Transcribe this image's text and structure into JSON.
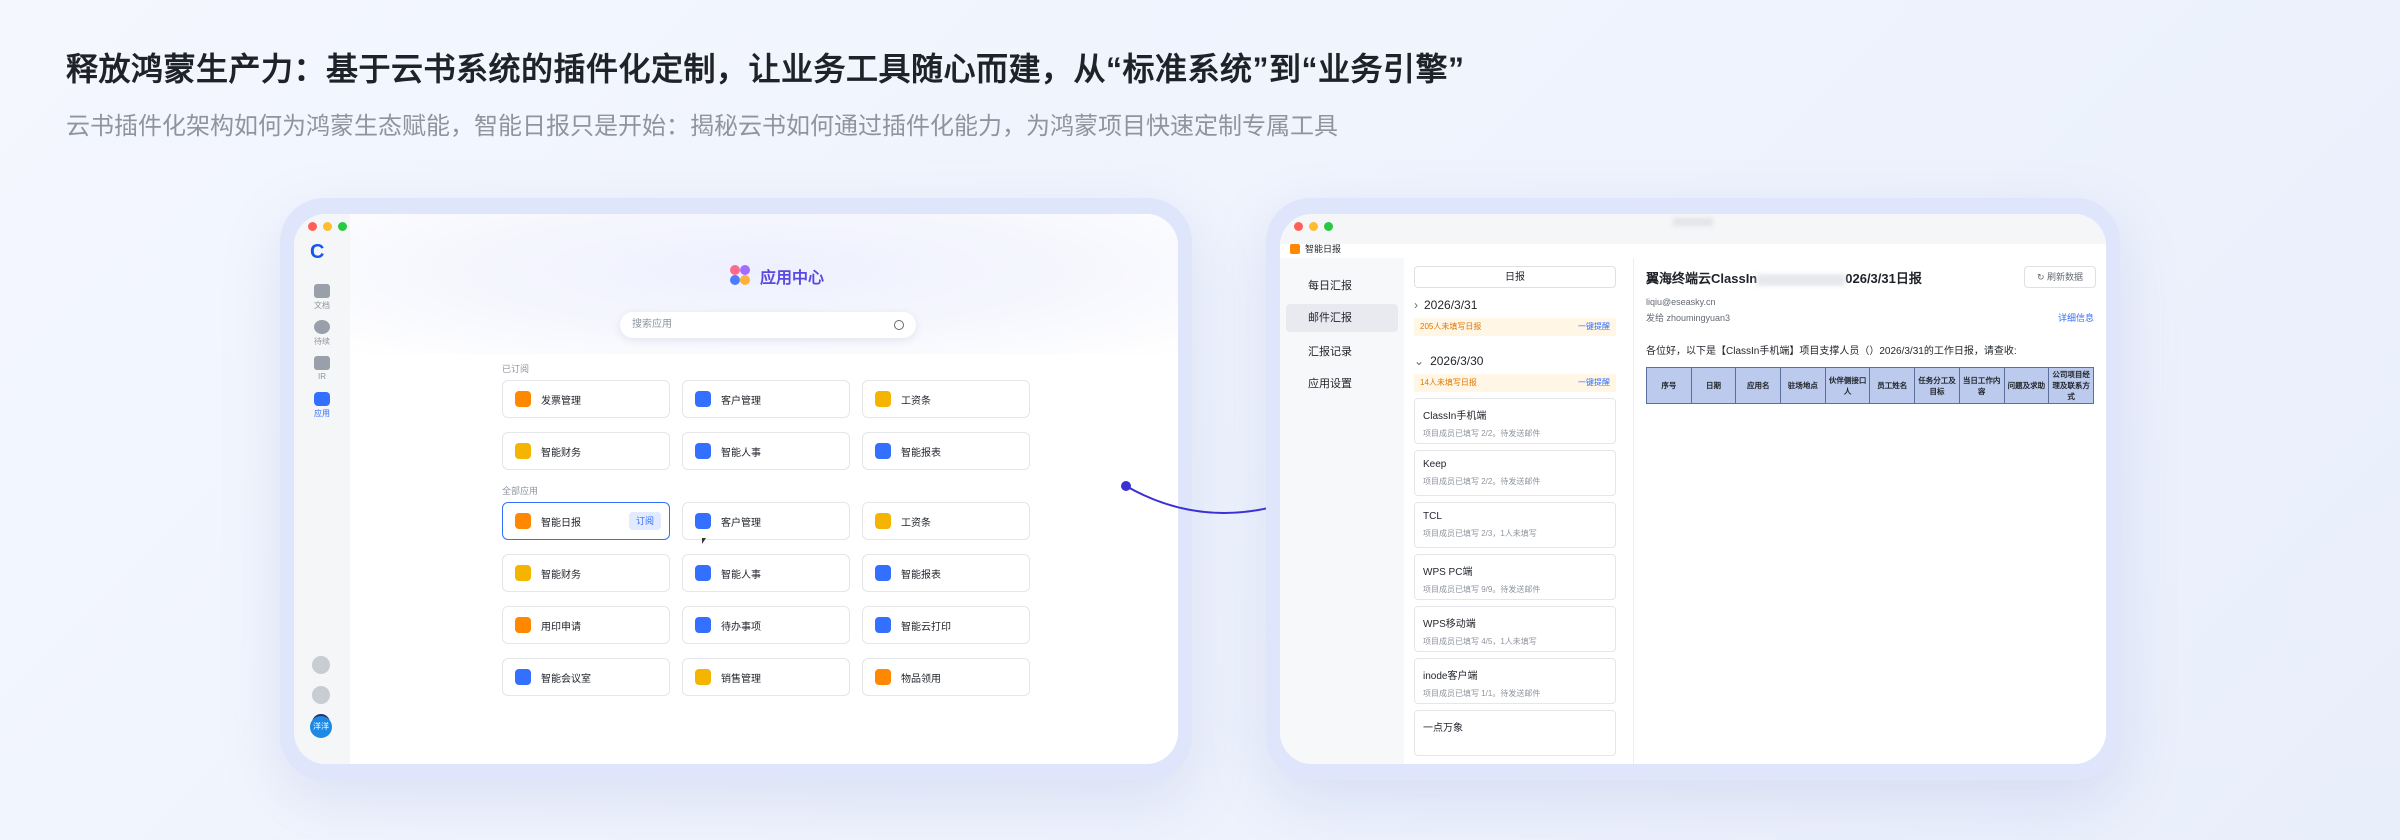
{
  "headline": "释放鸿蒙生产力：基于云书系统的插件化定制，让业务工具随心而建，从“标准系统”到“业务引擎”",
  "subline": "云书插件化架构如何为鸿蒙生态赋能，智能日报只是开始：揭秘云书如何通过插件化能力，为鸿蒙项目快速定制专属工具",
  "left_app": {
    "sidebar": {
      "items": [
        {
          "label": "文档"
        },
        {
          "label": "待续"
        },
        {
          "label": "IR"
        },
        {
          "label": "应用"
        }
      ],
      "avatar": "洋洋"
    },
    "hero_title": "应用中心",
    "search_placeholder": "搜索应用",
    "subscribed_label": "已订阅",
    "all_label": "全部应用",
    "subscribe_btn": "订阅",
    "subscribed": [
      {
        "label": "发票管理",
        "color": "#ff8800"
      },
      {
        "label": "客户管理",
        "color": "#3370ff"
      },
      {
        "label": "工资条",
        "color": "#f5b400"
      },
      {
        "label": "智能财务",
        "color": "#f5b400"
      },
      {
        "label": "智能人事",
        "color": "#3370ff"
      },
      {
        "label": "智能报表",
        "color": "#3370ff"
      }
    ],
    "all_apps": [
      {
        "label": "智能日报",
        "color": "#ff8800"
      },
      {
        "label": "客户管理",
        "color": "#3370ff"
      },
      {
        "label": "工资条",
        "color": "#f5b400"
      },
      {
        "label": "智能财务",
        "color": "#f5b400"
      },
      {
        "label": "智能人事",
        "color": "#3370ff"
      },
      {
        "label": "智能报表",
        "color": "#3370ff"
      },
      {
        "label": "用印申请",
        "color": "#ff8800"
      },
      {
        "label": "待办事项",
        "color": "#3370ff"
      },
      {
        "label": "智能云打印",
        "color": "#3370ff"
      },
      {
        "label": "智能会议室",
        "color": "#3370ff"
      },
      {
        "label": "销售管理",
        "color": "#f5b400"
      },
      {
        "label": "物品领用",
        "color": "#ff8800"
      }
    ]
  },
  "right_app": {
    "tab_title": "智能日报",
    "nav": [
      "每日汇报",
      "邮件汇报",
      "汇报记录",
      "应用设置"
    ],
    "segment": "日报",
    "date1": "2026/3/31",
    "warn1": "205人未填写日报",
    "date2": "2026/3/30",
    "warn2": "14人未填写日报",
    "remind": "一键提醒",
    "items": [
      {
        "title": "ClassIn手机端",
        "sub": "项目成员已填写 2/2。待发送邮件"
      },
      {
        "title": "Keep",
        "sub": "项目成员已填写 2/2。待发送邮件"
      },
      {
        "title": "TCL",
        "sub": "项目成员已填写 2/3，1人未填写"
      },
      {
        "title": "WPS PC端",
        "sub": "项目成员已填写 9/9。待发送邮件"
      },
      {
        "title": "WPS移动端",
        "sub": "项目成员已填写 4/5，1人未填写"
      },
      {
        "title": "inode客户端",
        "sub": "项目成员已填写 1/1。待发送邮件"
      },
      {
        "title": "一点万象",
        "sub": ""
      }
    ],
    "detail_title_a": "翼海终端云ClassIn",
    "detail_title_b": "026/3/31日报",
    "refresh": "刷新数据",
    "mail": "liqiu@eseasky.cn",
    "from": "发给 zhoumingyuan3",
    "more": "详细信息",
    "greet": "各位好，以下是【ClassIn手机端】项目支撑人员（）2026/3/31的工作日报，请查收:",
    "table_headers": [
      "序号",
      "日期",
      "应用名",
      "驻场地点",
      "伙伴侧接口人",
      "员工姓名",
      "任务分工及目标",
      "当日工作内容",
      "问题及求助",
      "公司项目经理及联系方式"
    ]
  },
  "colors": {
    "accent": "#3370ff",
    "connector": "#3b2fd6"
  }
}
